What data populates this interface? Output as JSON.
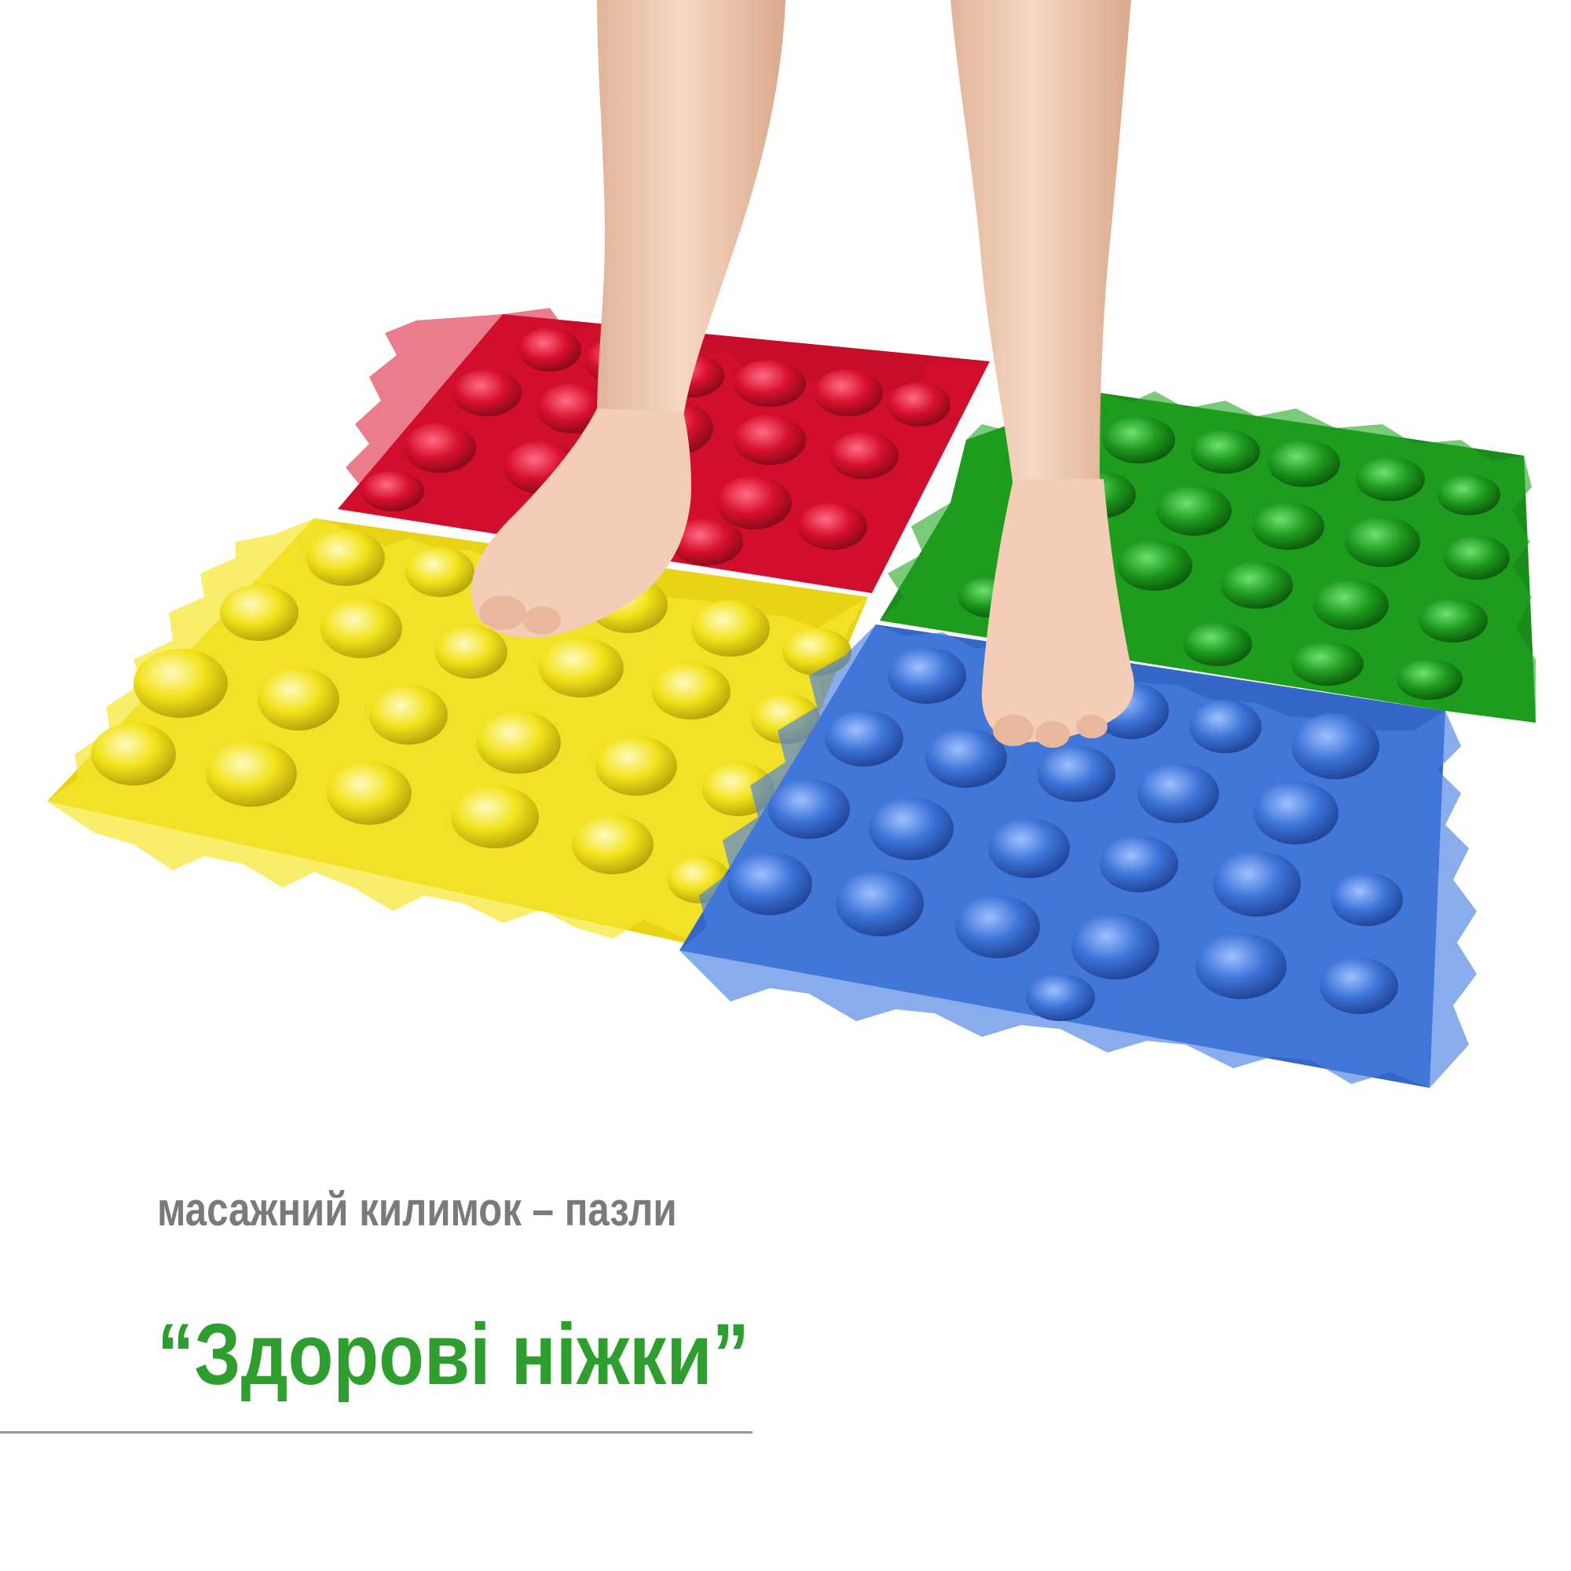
{
  "caption": {
    "line1": "масажний килимок – пазли",
    "line2": "“Здорові ніжки”"
  },
  "colors": {
    "caption_line1": "#7a7a7a",
    "caption_line2": "#2e9e2e",
    "tile_red": "#d8102e",
    "tile_green": "#1e9a1e",
    "tile_yellow": "#f2e21a",
    "tile_blue": "#3d73d8",
    "skin": "#f3cdb5",
    "divider": "#9a9a9a"
  }
}
